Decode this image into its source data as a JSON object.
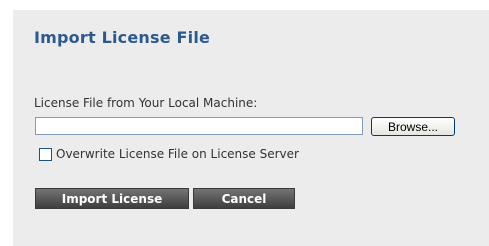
{
  "dialog": {
    "title": "Import License File",
    "file_field": {
      "label": "License File from Your Local Machine:",
      "value": "",
      "browse_label": "Browse..."
    },
    "overwrite": {
      "label": "Overwrite License File on License Server",
      "checked": false
    },
    "buttons": {
      "import_label": "Import License",
      "cancel_label": "Cancel"
    }
  },
  "colors": {
    "title": "#2c5a8c",
    "panel_background": "#ececec",
    "button_background": "#4f4f4f"
  }
}
